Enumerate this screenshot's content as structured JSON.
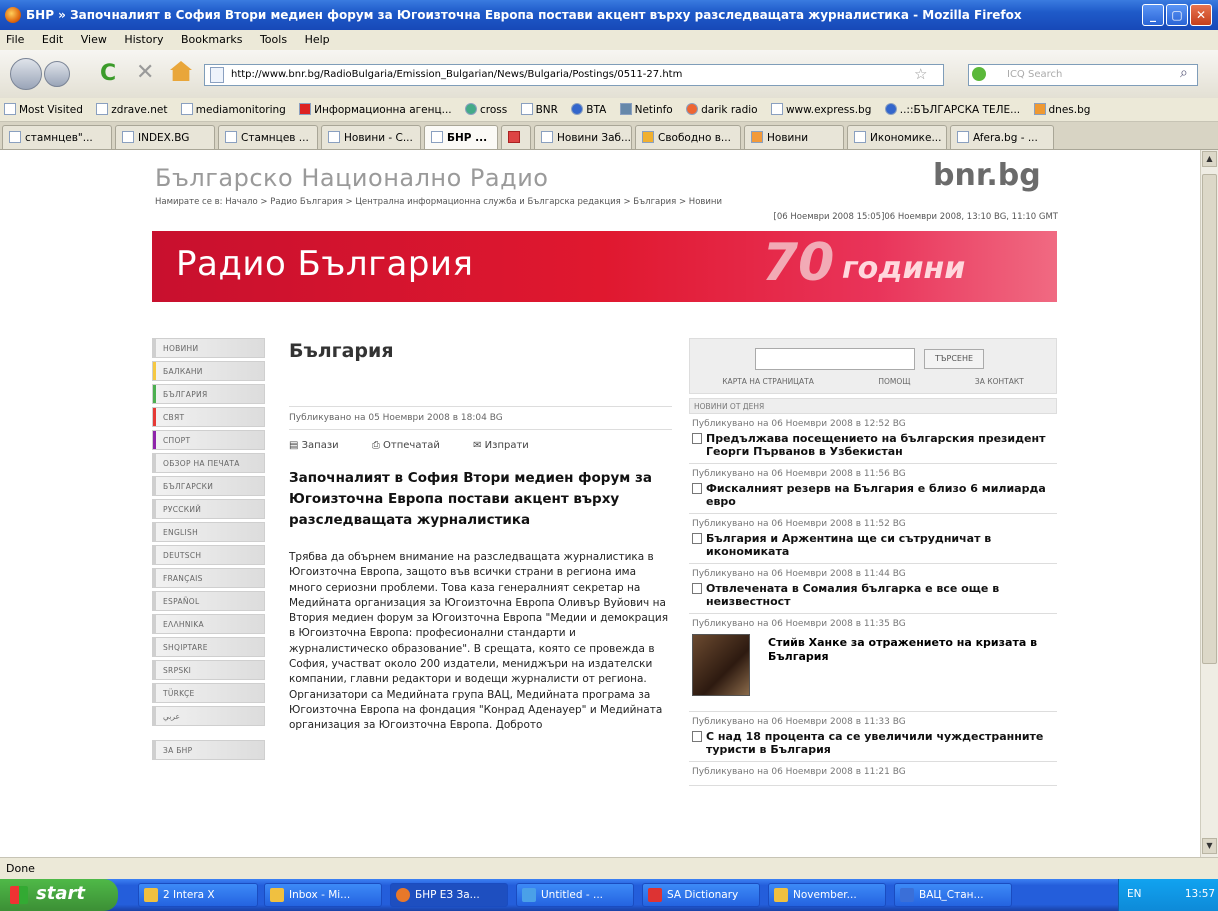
{
  "window": {
    "title": "БНР » Започналият в София Втори медиен форум за Югоизточна Европа постави акцент върху разследващата журналистика - Mozilla Firefox",
    "minimize": "_",
    "maximize": "▢",
    "close": "✕"
  },
  "menu": [
    "File",
    "Edit",
    "View",
    "History",
    "Bookmarks",
    "Tools",
    "Help"
  ],
  "nav": {
    "url": "http://www.bnr.bg/RadioBulgaria/Emission_Bulgarian/News/Bulgaria/Postings/0511-27.htm",
    "search_placeholder": "ICQ Search"
  },
  "bookmarks": [
    "Most Visited",
    "zdrave.net",
    "mediamonitoring",
    "Информационна агенц...",
    "cross",
    "BNR",
    "BTA",
    "Netinfo",
    "darik radio",
    "www.express.bg",
    "..::БЪЛГАРСКА ТЕЛЕ...",
    "dnes.bg"
  ],
  "tabs": [
    {
      "label": "стамнцев\"..."
    },
    {
      "label": "INDEX.BG"
    },
    {
      "label": "Стамнцев ..."
    },
    {
      "label": "Новини - С..."
    },
    {
      "label": "БНР ...",
      "active": true
    },
    {
      "label": ""
    },
    {
      "label": "Новини Заб..."
    },
    {
      "label": "Свободно в..."
    },
    {
      "label": "Новини"
    },
    {
      "label": "Икономике..."
    },
    {
      "label": "Afera.bg - ..."
    }
  ],
  "page": {
    "site_name": "Българско Национално Радио",
    "site_logo": "bnr.bg",
    "breadcrumb": "Намирате се в: Начало > Радио България > Централна информационна служба и Българска редакция > България > Новини",
    "date_line": "[06 Ноември 2008 15:05]06 Ноември 2008, 13:10 BG, 11:10 GMT",
    "banner_title": "Радио България",
    "banner_70": "70",
    "banner_years": "години",
    "left_nav": [
      {
        "label": "НОВИНИ",
        "color": "#cfcfcf"
      },
      {
        "label": "БАЛКАНИ",
        "color": "#f5c842"
      },
      {
        "label": "БЪЛГАРИЯ",
        "color": "#4caf50"
      },
      {
        "label": "СВЯТ",
        "color": "#e53935"
      },
      {
        "label": "СПОРТ",
        "color": "#8e24aa"
      },
      {
        "label": "ОБЗОР НА ПЕЧАТА",
        "color": "#cfcfcf"
      },
      {
        "label": "БЪЛГАРСКИ",
        "color": "#cfcfcf"
      },
      {
        "label": "РУССКИЙ",
        "color": "#cfcfcf"
      },
      {
        "label": "ENGLISH",
        "color": "#cfcfcf"
      },
      {
        "label": "DEUTSCH",
        "color": "#cfcfcf"
      },
      {
        "label": "FRANÇAIS",
        "color": "#cfcfcf"
      },
      {
        "label": "ESPAÑOL",
        "color": "#cfcfcf"
      },
      {
        "label": "ΕΛΛΗΝΙΚΑ",
        "color": "#cfcfcf"
      },
      {
        "label": "SHQIPTARE",
        "color": "#cfcfcf"
      },
      {
        "label": "SRPSKI",
        "color": "#cfcfcf"
      },
      {
        "label": "TÜRKÇE",
        "color": "#cfcfcf"
      },
      {
        "label": "عربي",
        "color": "#cfcfcf"
      },
      {
        "label": "ЗА БНР",
        "color": "#cfcfcf"
      }
    ],
    "section_title": "България",
    "published": "Публикувано на 05 Ноември 2008 в 18:04 BG",
    "tools": {
      "bookmark": "Запази",
      "print": "Отпечатай",
      "send": "Изпрати"
    },
    "headline": "Започналият в София Втори медиен форум за Югоизточна Европа постави акцент върху разследващата журналистика",
    "body": "Трябва да обърнем внимание на разследващата журналистика в Югоизточна Европа, защото във всички страни в региона има много сериозни проблеми. Това каза генералният секретар на Медийната организация за Югоизточна Европа Оливър Вуйович на Втория медиен форум за Югоизточна Европа \"Медии и демокрация в Югоизточна Европа: професионални стандарти и журналистическо образование\". В срещата, която се провежда в София, участват около 200 издатели, мениджъри на издателски компании, главни редактори и водещи журналисти от региона. Организатори са Медийната група ВАЦ, Медийната програма за Югоизточна Европа на фондация \"Конрад Аденауер\" и Медийната организация за Югоизточна Европа. Доброто",
    "right": {
      "search_button": "ТЪРСЕНЕ",
      "links": [
        "КАРТА НА СТРАНИЦАТА",
        "ПОМОЩ",
        "ЗА КОНТАКТ"
      ],
      "news_header": "НОВИНИ ОТ ДЕНЯ",
      "news": [
        {
          "date": "Публикувано на 06 Ноември 2008 в 12:52 BG",
          "title": "Предължава посещението на българския президент Георги Първанов в Узбекистан"
        },
        {
          "date": "Публикувано на 06 Ноември 2008 в 11:56 BG",
          "title": "Фискалният резерв на България е близо 6 милиарда евро"
        },
        {
          "date": "Публикувано на 06 Ноември 2008 в 11:52 BG",
          "title": "България и Аржентина ще си сътрудничат в икономиката"
        },
        {
          "date": "Публикувано на 06 Ноември 2008 в 11:44 BG",
          "title": "Отвлечената в Сомалия българка е все още в неизвестност"
        },
        {
          "date": "Публикувано на 06 Ноември 2008 в 11:35 BG",
          "title": "Стийв Ханке за отражението на кризата в България",
          "photo": true
        },
        {
          "date": "Публикувано на 06 Ноември 2008 в 11:33 BG",
          "title": "С над 18 процента са се увеличили чуждестранните туристи в България"
        },
        {
          "date": "Публикувано на 06 Ноември 2008 в 11:21 BG",
          "title": ""
        }
      ]
    }
  },
  "status": "Done",
  "taskbar": {
    "start": "start",
    "buttons": [
      {
        "label": "2 Intera X"
      },
      {
        "label": "Inbox - Mi..."
      },
      {
        "label": "БНР ЕЗ За...",
        "active": true
      },
      {
        "label": "Untitled - ..."
      },
      {
        "label": "SA Dictionary"
      },
      {
        "label": "November..."
      },
      {
        "label": "ВАЦ_Стан..."
      }
    ],
    "lang": "EN",
    "clock": "13:57"
  }
}
